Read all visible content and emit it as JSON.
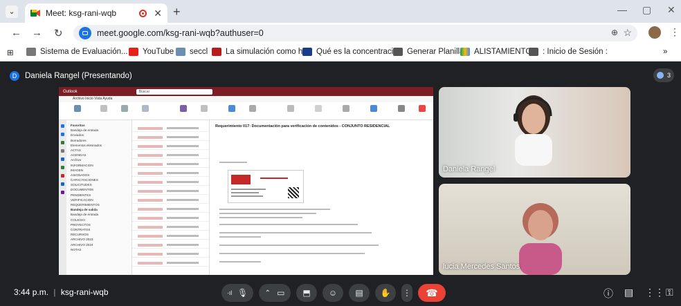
{
  "browser": {
    "tab_title": "Meet: ksg-rani-wqb",
    "url": "meet.google.com/ksg-rani-wqb?authuser=0",
    "bookmarks": [
      "Sistema de Evaluación...",
      "YouTube",
      "seccl",
      "La simulación como h...",
      "Qué es la concentraci...",
      "Generar Planilla",
      "ALISTAMIENTOS",
      ": Inicio de Sesión :"
    ]
  },
  "meet": {
    "presenter_label": "Daniela Rangel (Presentando)",
    "presenter_initial": "D",
    "participant_count": "3",
    "time": "3:44 p.m.",
    "separator": "|",
    "meeting_code": "ksg-rani-wqb",
    "participants": [
      {
        "name": "Daniela Rangel"
      },
      {
        "name": "lucia Mercedes Santos"
      }
    ]
  },
  "shared_screen": {
    "app_name": "Outlook",
    "search_placeholder": "Buscar",
    "menu": "Archivo  Inicio  Vista  Ayuda",
    "subject": "Requerimiento 017: Documentación para verificación de contenidos - CONJUNTO RESIDENCIAL",
    "folders": [
      "Favoritos",
      "Bandeja de entrada",
      "Enviados",
      "Borradores",
      "Elementos eliminados",
      "ACTAS",
      "AGENDAS",
      "Archivo",
      "INFORMACION",
      "IMAGEN",
      "ASIGNADOS",
      "CAPACITACIONES",
      "SOLICITUDES",
      "DOCUMENTOS",
      "PENDIENTES",
      "VERIFICACION",
      "REQUERIMIENTOS",
      "Bandeja de salida",
      "Bandeja de entrada",
      "COLEGIO",
      "PROYECTOS",
      "CONTRATOS",
      "RECURSOS",
      "ARCHIVO 2023",
      "ARCHIVO 2024",
      "NOTAS"
    ]
  },
  "colors": {
    "outlook_title": "#7a1e24",
    "meet_bg": "#202124",
    "end_call": "#ea4335",
    "accent": "#1a73e8"
  }
}
